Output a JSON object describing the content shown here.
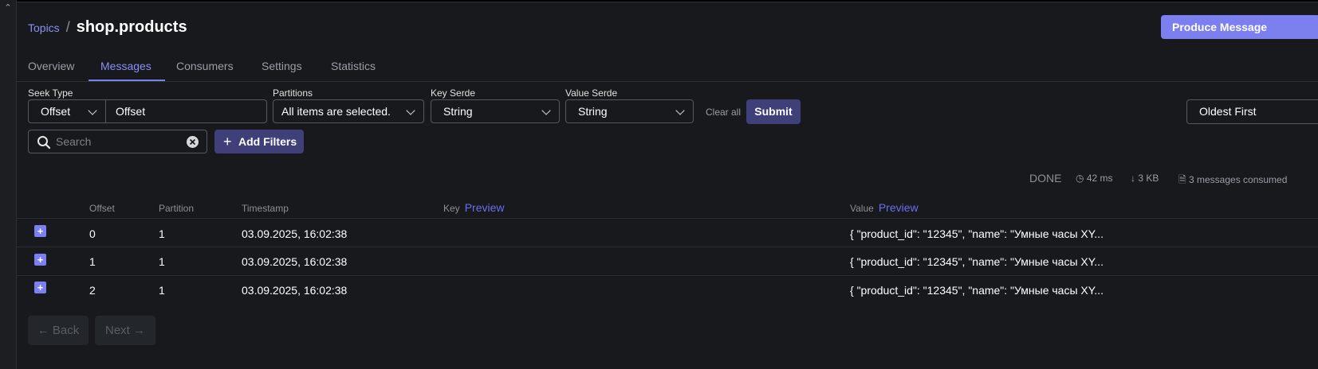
{
  "breadcrumb": {
    "link": "Topics",
    "separator": "/",
    "title": "shop.products"
  },
  "header": {
    "produce_button": "Produce Message"
  },
  "tabs": [
    "Overview",
    "Messages",
    "Consumers",
    "Settings",
    "Statistics"
  ],
  "active_tab": "Messages",
  "filters": {
    "seek_type": {
      "label": "Seek Type",
      "value": "Offset",
      "input_value": "Offset"
    },
    "partitions": {
      "label": "Partitions",
      "value": "All items are selected."
    },
    "key_serde": {
      "label": "Key Serde",
      "value": "String"
    },
    "value_serde": {
      "label": "Value Serde",
      "value": "String"
    },
    "clear_all": "Clear all",
    "submit": "Submit",
    "sort": "Oldest First"
  },
  "search": {
    "placeholder": "Search",
    "add_filters": "Add Filters"
  },
  "stats": {
    "status": "DONE",
    "time": "42 ms",
    "size": "3 KB",
    "messages": "3 messages consumed"
  },
  "table": {
    "columns": {
      "offset": "Offset",
      "partition": "Partition",
      "timestamp": "Timestamp",
      "key": "Key",
      "value": "Value",
      "preview": "Preview"
    },
    "rows": [
      {
        "offset": "0",
        "partition": "1",
        "timestamp": "03.09.2025, 16:02:38",
        "key": "",
        "value": "{ \"product_id\": \"12345\", \"name\": \"Умные часы XY..."
      },
      {
        "offset": "1",
        "partition": "1",
        "timestamp": "03.09.2025, 16:02:38",
        "key": "",
        "value": "{ \"product_id\": \"12345\", \"name\": \"Умные часы XY..."
      },
      {
        "offset": "2",
        "partition": "1",
        "timestamp": "03.09.2025, 16:02:38",
        "key": "",
        "value": "{ \"product_id\": \"12345\", \"name\": \"Умные часы XY..."
      }
    ]
  },
  "pagination": {
    "back": "← Back",
    "next": "Next →"
  },
  "colors": {
    "accent": "#7b7ff0",
    "button_dark": "#3f3f7a",
    "background": "#17191c"
  }
}
